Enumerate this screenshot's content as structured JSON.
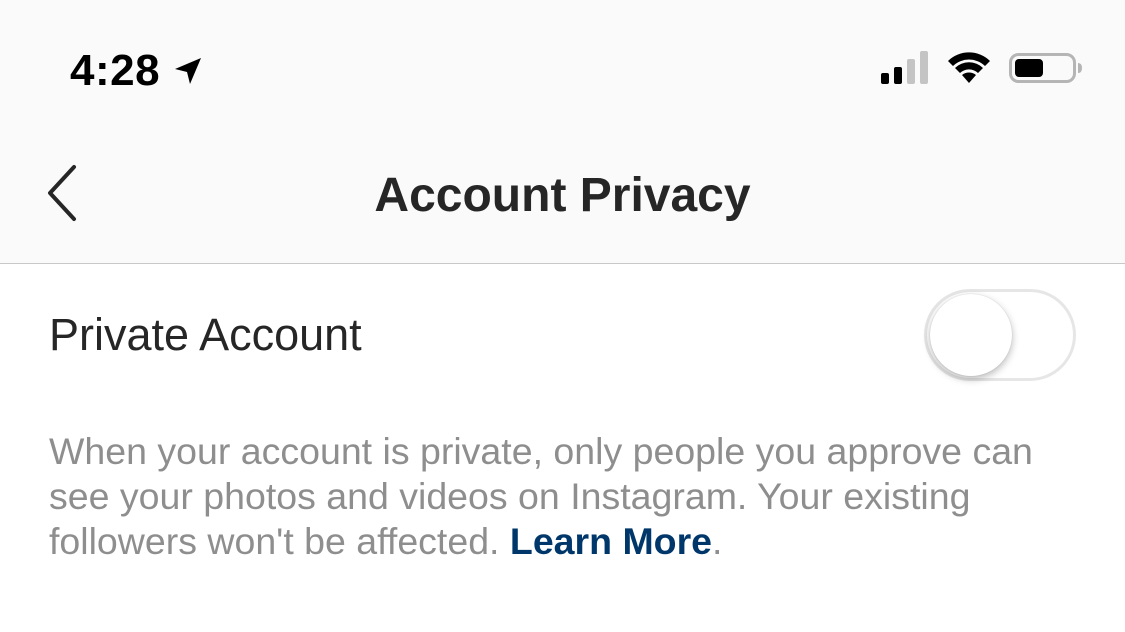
{
  "status_bar": {
    "time": "4:28",
    "icons": [
      "location-arrow-icon",
      "cellular-signal-icon",
      "wifi-icon",
      "battery-icon"
    ]
  },
  "nav": {
    "back_icon": "chevron-left-icon",
    "title": "Account Privacy"
  },
  "settings": {
    "private_account": {
      "label": "Private Account",
      "enabled": false
    },
    "description": {
      "text": "When your account is private, only people you approve can see your photos and videos on Instagram. Your existing followers won't be affected. ",
      "link_text": "Learn More",
      "trailing": "."
    }
  },
  "colors": {
    "header_background": "#fafafa",
    "text_primary": "#262626",
    "text_secondary": "#8e8e8e",
    "link": "#00376b"
  }
}
